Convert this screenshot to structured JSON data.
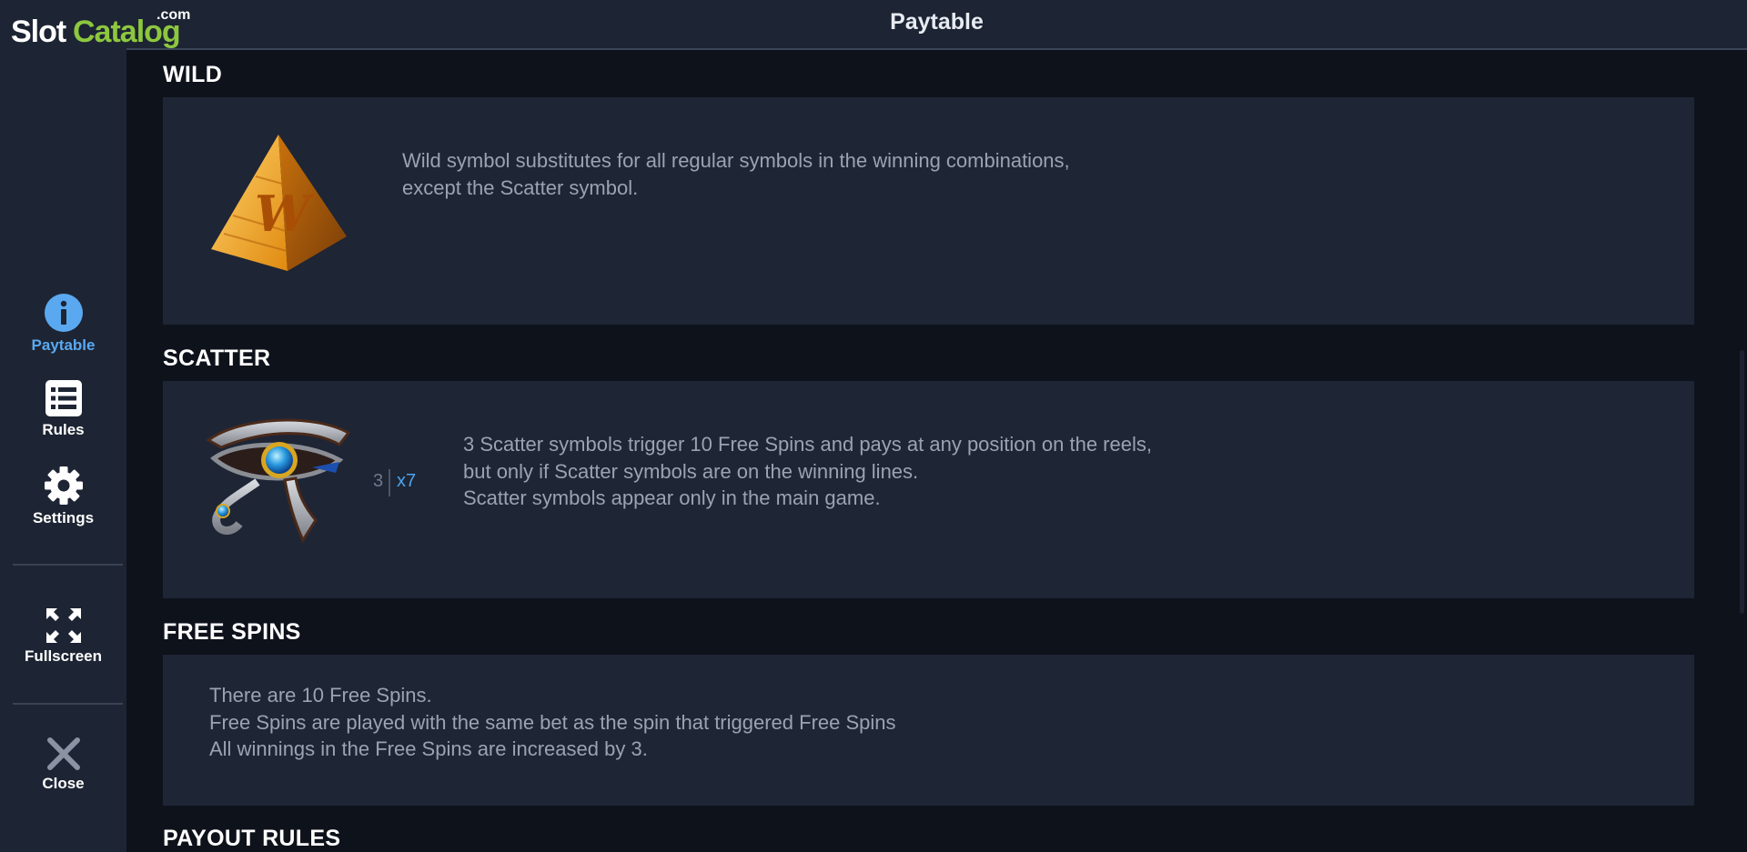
{
  "logo": {
    "slot": "Slot",
    "catalog": "Catalog",
    "com": ".com"
  },
  "header": {
    "title": "Paytable"
  },
  "sidebar": {
    "items": [
      {
        "label": "Paytable",
        "icon": "info-icon",
        "active": true
      },
      {
        "label": "Rules",
        "icon": "list-icon",
        "active": false
      },
      {
        "label": "Settings",
        "icon": "gear-icon",
        "active": false
      },
      {
        "label": "Fullscreen",
        "icon": "fullscreen-icon",
        "active": false
      },
      {
        "label": "Close",
        "icon": "close-icon",
        "active": false
      }
    ]
  },
  "sections": {
    "wild": {
      "title": "WILD",
      "symbol": "pyramid-wild-icon",
      "description": "Wild symbol substitutes for all regular symbols in the winning combinations,\nexcept the Scatter symbol."
    },
    "scatter": {
      "title": "SCATTER",
      "symbol": "eye-of-horus-icon",
      "pay_count": "3",
      "pay_multiplier": "x7",
      "description": "3 Scatter symbols trigger 10 Free Spins and pays at any position on the reels,\nbut only if Scatter symbols are on the winning lines.\nScatter symbols appear only in the main game."
    },
    "free_spins": {
      "title": "FREE SPINS",
      "description": "There are 10 Free Spins.\nFree Spins are played with the same bet as the spin that triggered Free Spins\nAll winnings in the Free Spins are increased by 3."
    },
    "payout_rules": {
      "title": "PAYOUT RULES"
    }
  },
  "colors": {
    "accent": "#5aa9f0",
    "sidebar_bg": "#1d2433",
    "panel_bg": "#1e2535",
    "page_bg": "#0e121b",
    "logo_green": "#8dc73f"
  }
}
